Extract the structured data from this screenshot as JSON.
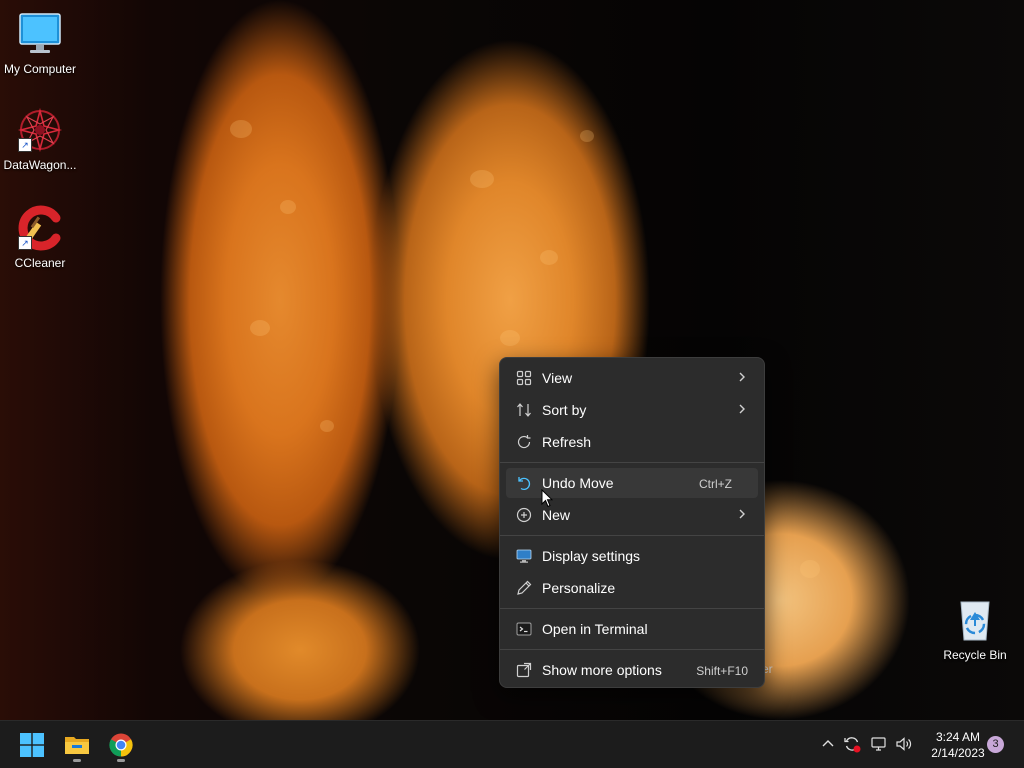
{
  "desktop": {
    "icons": [
      {
        "label": "My Computer",
        "icon": "monitor-icon"
      },
      {
        "label": "DataWagon...",
        "icon": "datawagon-icon"
      },
      {
        "label": "CCleaner",
        "icon": "ccleaner-icon"
      },
      {
        "label": "Recycle Bin",
        "icon": "recycle-bin-icon"
      }
    ],
    "behind_menu_text": "er"
  },
  "context_menu": {
    "items": [
      {
        "label": "View",
        "icon": "grid-icon",
        "submenu": true
      },
      {
        "label": "Sort by",
        "icon": "sort-icon",
        "submenu": true
      },
      {
        "label": "Refresh",
        "icon": "refresh-icon"
      },
      {
        "label": "Undo Move",
        "icon": "undo-icon",
        "shortcut": "Ctrl+Z",
        "highlighted": true
      },
      {
        "label": "New",
        "icon": "plus-circle-icon",
        "submenu": true
      },
      {
        "label": "Display settings",
        "icon": "display-icon"
      },
      {
        "label": "Personalize",
        "icon": "pen-icon"
      },
      {
        "label": "Open in Terminal",
        "icon": "terminal-icon"
      },
      {
        "label": "Show more options",
        "icon": "more-options-icon",
        "shortcut": "Shift+F10"
      }
    ]
  },
  "taskbar": {
    "buttons": [
      {
        "name": "start",
        "icon": "windows-logo-icon"
      },
      {
        "name": "file-explorer",
        "icon": "folder-icon"
      },
      {
        "name": "chrome",
        "icon": "chrome-icon"
      }
    ],
    "tray": [
      "chevron-up-icon",
      "sync-error-icon",
      "network-icon",
      "volume-icon"
    ],
    "time": "3:24 AM",
    "date": "2/14/2023",
    "notification_count": "3"
  },
  "colors": {
    "menu_bg": "#2c2c2c",
    "menu_hover": "#383838",
    "taskbar_bg": "#1c1c1c",
    "accent": "#4cc2ff"
  }
}
